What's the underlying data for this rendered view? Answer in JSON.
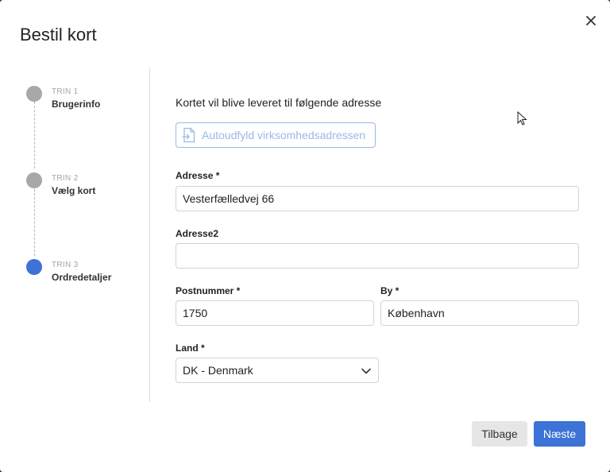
{
  "dialog": {
    "title": "Bestil kort",
    "close_icon": "close-icon"
  },
  "stepper": {
    "steps": [
      {
        "number": "TRIN 1",
        "name": "Brugerinfo",
        "state": "done"
      },
      {
        "number": "TRIN 2",
        "name": "Vælg kort",
        "state": "done"
      },
      {
        "number": "TRIN 3",
        "name": "Ordredetaljer",
        "state": "active"
      }
    ],
    "colors": {
      "done": "#a8a8a8",
      "active": "#3d72d6"
    }
  },
  "form": {
    "intro": "Kortet vil blive leveret til følgende adresse",
    "autofill_label": "Autoudfyld virksomhedsadressen",
    "autofill_icon": "document-arrow-icon",
    "address": {
      "label": "Adresse *",
      "value": "Vesterfælledvej 66"
    },
    "address2": {
      "label": "Adresse2",
      "value": ""
    },
    "postcode": {
      "label": "Postnummer *",
      "value": "1750"
    },
    "city": {
      "label": "By *",
      "value": "København"
    },
    "country": {
      "label": "Land *",
      "value": "DK - Denmark"
    }
  },
  "footer": {
    "back_label": "Tilbage",
    "next_label": "Næste",
    "accent": "#3d72d6"
  }
}
